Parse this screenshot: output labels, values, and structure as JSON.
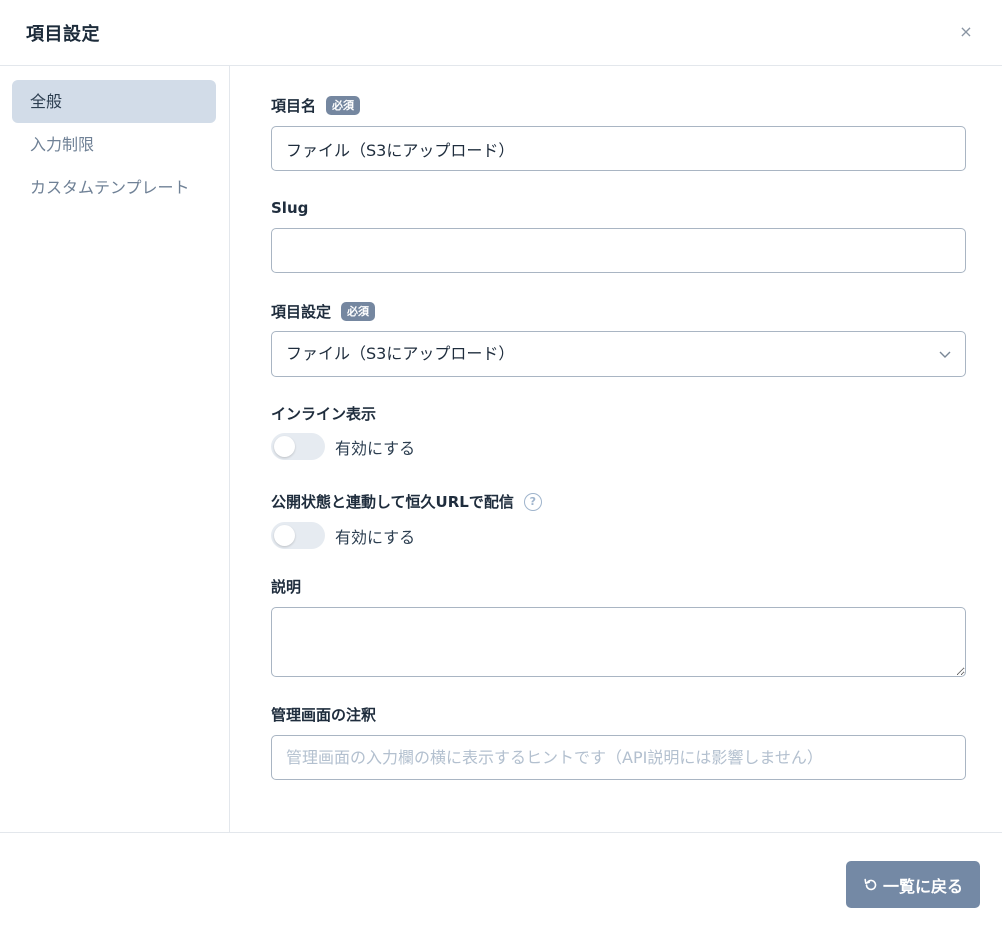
{
  "dialog": {
    "title": "項目設定",
    "close_label": "×"
  },
  "sidebar": {
    "items": [
      {
        "label": "全般",
        "active": true
      },
      {
        "label": "入力制限",
        "active": false
      },
      {
        "label": "カスタムテンプレート",
        "active": false
      }
    ]
  },
  "form": {
    "field_name": {
      "label": "項目名",
      "badge": "必須",
      "value": "ファイル（S3にアップロード）"
    },
    "slug": {
      "label": "Slug",
      "value": ""
    },
    "field_type": {
      "label": "項目設定",
      "badge": "必須",
      "selected": "ファイル（S3にアップロード）"
    },
    "inline_display": {
      "label": "インライン表示",
      "toggle_label": "有効にする",
      "enabled": false
    },
    "permanent_url": {
      "label": "公開状態と連動して恒久URLで配信",
      "help_icon": "?",
      "toggle_label": "有効にする",
      "enabled": false
    },
    "description": {
      "label": "説明",
      "value": ""
    },
    "admin_note": {
      "label": "管理画面の注釈",
      "placeholder": "管理画面の入力欄の横に表示するヒントです（API説明には影響しません）"
    }
  },
  "footer": {
    "back_button": {
      "label": "一覧に戻る",
      "icon": "undo-icon",
      "color": "#7489a5"
    }
  }
}
